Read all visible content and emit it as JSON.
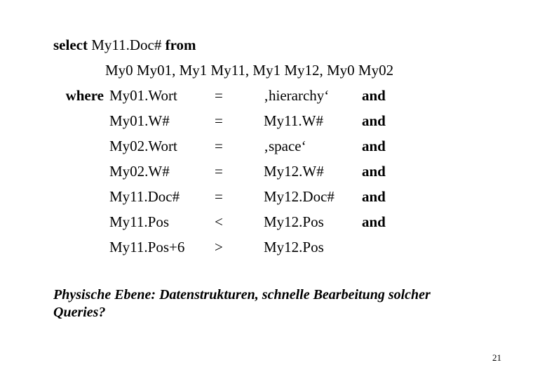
{
  "slide": {
    "query": {
      "select_keyword": "select",
      "select_expression": "My11.Doc#",
      "from_keyword": "from",
      "from_tables": "My0 My01, My1 My11, My1 My12, My0 My02",
      "where_keyword": "where",
      "conditions": [
        {
          "left": "My01.Wort",
          "operator": "=",
          "right": "‚hierarchy‘",
          "connector": "and"
        },
        {
          "left": "My01.W#",
          "operator": "=",
          "right": "My11.W#",
          "connector": "and"
        },
        {
          "left": "My02.Wort",
          "operator": "=",
          "right": "‚space‘",
          "connector": "and"
        },
        {
          "left": "My02.W#",
          "operator": "=",
          "right": "My12.W#",
          "connector": "and"
        },
        {
          "left": "My11.Doc#",
          "operator": "=",
          "right": "My12.Doc#",
          "connector": "and"
        },
        {
          "left": "My11.Pos",
          "operator": "<",
          "right": "My12.Pos",
          "connector": "and"
        },
        {
          "left": "My11.Pos+6",
          "operator": ">",
          "right": "My12.Pos",
          "connector": ""
        }
      ]
    },
    "caption": "Physische Ebene: Datenstrukturen, schnelle Bearbeitung solcher Queries?",
    "page_number": "21"
  }
}
